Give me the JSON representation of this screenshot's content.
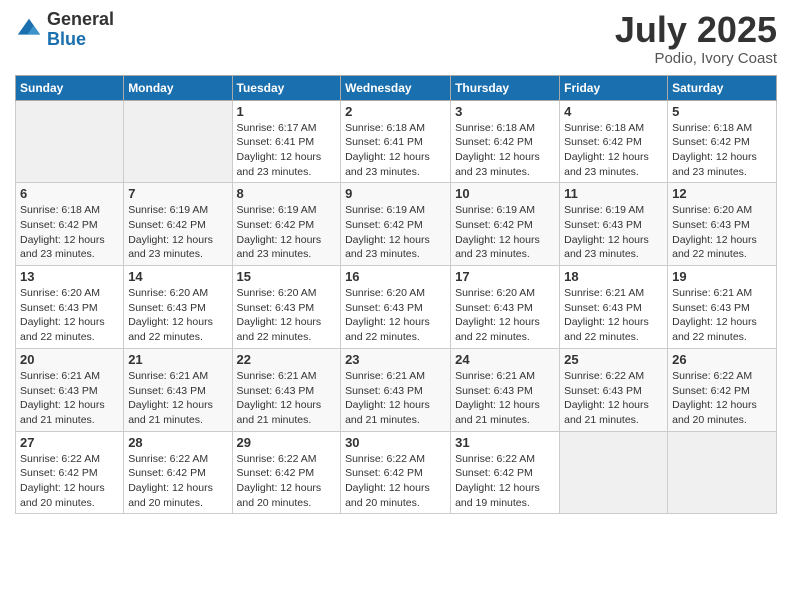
{
  "logo": {
    "general": "General",
    "blue": "Blue"
  },
  "header": {
    "title": "July 2025",
    "subtitle": "Podio, Ivory Coast"
  },
  "weekdays": [
    "Sunday",
    "Monday",
    "Tuesday",
    "Wednesday",
    "Thursday",
    "Friday",
    "Saturday"
  ],
  "weeks": [
    [
      {
        "day": "",
        "info": ""
      },
      {
        "day": "",
        "info": ""
      },
      {
        "day": "1",
        "info": "Sunrise: 6:17 AM\nSunset: 6:41 PM\nDaylight: 12 hours\nand 23 minutes."
      },
      {
        "day": "2",
        "info": "Sunrise: 6:18 AM\nSunset: 6:41 PM\nDaylight: 12 hours\nand 23 minutes."
      },
      {
        "day": "3",
        "info": "Sunrise: 6:18 AM\nSunset: 6:42 PM\nDaylight: 12 hours\nand 23 minutes."
      },
      {
        "day": "4",
        "info": "Sunrise: 6:18 AM\nSunset: 6:42 PM\nDaylight: 12 hours\nand 23 minutes."
      },
      {
        "day": "5",
        "info": "Sunrise: 6:18 AM\nSunset: 6:42 PM\nDaylight: 12 hours\nand 23 minutes."
      }
    ],
    [
      {
        "day": "6",
        "info": "Sunrise: 6:18 AM\nSunset: 6:42 PM\nDaylight: 12 hours\nand 23 minutes."
      },
      {
        "day": "7",
        "info": "Sunrise: 6:19 AM\nSunset: 6:42 PM\nDaylight: 12 hours\nand 23 minutes."
      },
      {
        "day": "8",
        "info": "Sunrise: 6:19 AM\nSunset: 6:42 PM\nDaylight: 12 hours\nand 23 minutes."
      },
      {
        "day": "9",
        "info": "Sunrise: 6:19 AM\nSunset: 6:42 PM\nDaylight: 12 hours\nand 23 minutes."
      },
      {
        "day": "10",
        "info": "Sunrise: 6:19 AM\nSunset: 6:42 PM\nDaylight: 12 hours\nand 23 minutes."
      },
      {
        "day": "11",
        "info": "Sunrise: 6:19 AM\nSunset: 6:43 PM\nDaylight: 12 hours\nand 23 minutes."
      },
      {
        "day": "12",
        "info": "Sunrise: 6:20 AM\nSunset: 6:43 PM\nDaylight: 12 hours\nand 22 minutes."
      }
    ],
    [
      {
        "day": "13",
        "info": "Sunrise: 6:20 AM\nSunset: 6:43 PM\nDaylight: 12 hours\nand 22 minutes."
      },
      {
        "day": "14",
        "info": "Sunrise: 6:20 AM\nSunset: 6:43 PM\nDaylight: 12 hours\nand 22 minutes."
      },
      {
        "day": "15",
        "info": "Sunrise: 6:20 AM\nSunset: 6:43 PM\nDaylight: 12 hours\nand 22 minutes."
      },
      {
        "day": "16",
        "info": "Sunrise: 6:20 AM\nSunset: 6:43 PM\nDaylight: 12 hours\nand 22 minutes."
      },
      {
        "day": "17",
        "info": "Sunrise: 6:20 AM\nSunset: 6:43 PM\nDaylight: 12 hours\nand 22 minutes."
      },
      {
        "day": "18",
        "info": "Sunrise: 6:21 AM\nSunset: 6:43 PM\nDaylight: 12 hours\nand 22 minutes."
      },
      {
        "day": "19",
        "info": "Sunrise: 6:21 AM\nSunset: 6:43 PM\nDaylight: 12 hours\nand 22 minutes."
      }
    ],
    [
      {
        "day": "20",
        "info": "Sunrise: 6:21 AM\nSunset: 6:43 PM\nDaylight: 12 hours\nand 21 minutes."
      },
      {
        "day": "21",
        "info": "Sunrise: 6:21 AM\nSunset: 6:43 PM\nDaylight: 12 hours\nand 21 minutes."
      },
      {
        "day": "22",
        "info": "Sunrise: 6:21 AM\nSunset: 6:43 PM\nDaylight: 12 hours\nand 21 minutes."
      },
      {
        "day": "23",
        "info": "Sunrise: 6:21 AM\nSunset: 6:43 PM\nDaylight: 12 hours\nand 21 minutes."
      },
      {
        "day": "24",
        "info": "Sunrise: 6:21 AM\nSunset: 6:43 PM\nDaylight: 12 hours\nand 21 minutes."
      },
      {
        "day": "25",
        "info": "Sunrise: 6:22 AM\nSunset: 6:43 PM\nDaylight: 12 hours\nand 21 minutes."
      },
      {
        "day": "26",
        "info": "Sunrise: 6:22 AM\nSunset: 6:42 PM\nDaylight: 12 hours\nand 20 minutes."
      }
    ],
    [
      {
        "day": "27",
        "info": "Sunrise: 6:22 AM\nSunset: 6:42 PM\nDaylight: 12 hours\nand 20 minutes."
      },
      {
        "day": "28",
        "info": "Sunrise: 6:22 AM\nSunset: 6:42 PM\nDaylight: 12 hours\nand 20 minutes."
      },
      {
        "day": "29",
        "info": "Sunrise: 6:22 AM\nSunset: 6:42 PM\nDaylight: 12 hours\nand 20 minutes."
      },
      {
        "day": "30",
        "info": "Sunrise: 6:22 AM\nSunset: 6:42 PM\nDaylight: 12 hours\nand 20 minutes."
      },
      {
        "day": "31",
        "info": "Sunrise: 6:22 AM\nSunset: 6:42 PM\nDaylight: 12 hours\nand 19 minutes."
      },
      {
        "day": "",
        "info": ""
      },
      {
        "day": "",
        "info": ""
      }
    ]
  ]
}
